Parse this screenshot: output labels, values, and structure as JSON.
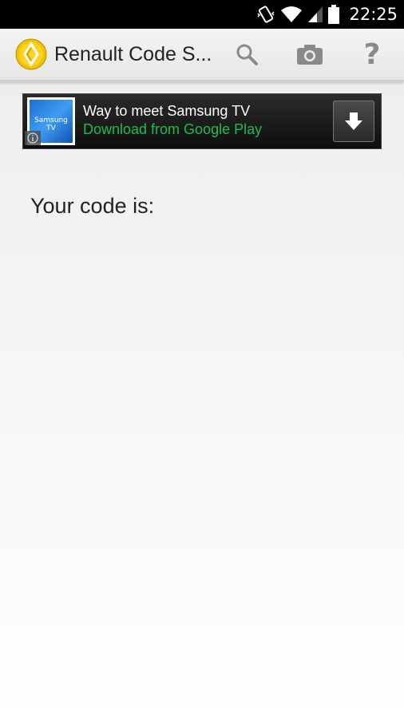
{
  "status_bar": {
    "time": "22:25"
  },
  "action_bar": {
    "title": "Renault Code S...",
    "logo_icon": "renault-diamond-icon",
    "actions": [
      {
        "name": "search",
        "icon": "search-icon"
      },
      {
        "name": "camera",
        "icon": "camera-icon"
      },
      {
        "name": "help",
        "icon": "help-icon",
        "glyph": "?"
      }
    ]
  },
  "ad": {
    "thumb_text": "Samsung TV",
    "title": "Way to meet Samsung TV",
    "subtitle": "Download from Google Play",
    "subtitle_color": "#1ebc55"
  },
  "main": {
    "code_label": "Your code is:"
  }
}
